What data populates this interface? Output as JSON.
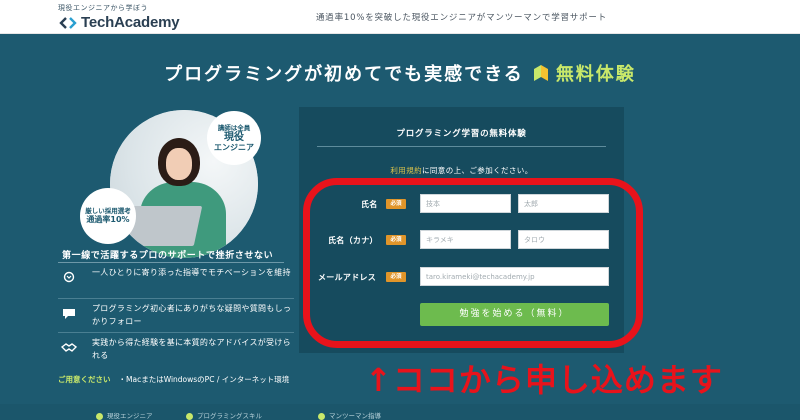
{
  "header": {
    "logo_sub": "現役エンジニアから学ぼう",
    "logo_text": "TechAcademy",
    "tagline": "通過率10%を突破した現役エンジニアがマンツーマンで学習サポート"
  },
  "headline": {
    "text": "プログラミングが初めてでも実感できる",
    "accent": "無料体験"
  },
  "badges": {
    "b1_line1": "講師は全員",
    "b1_line2": "現役",
    "b1_line3": "エンジニア",
    "b2_line1": "厳しい採用選考",
    "b2_line2": "通過率10%"
  },
  "left": {
    "section_title": "第一線で活躍するプロのサポートで挫折させない",
    "features": [
      {
        "text": "一人ひとりに寄り添った指導でモチベーションを維持"
      },
      {
        "text": "プログラミング初心者にありがちな疑問や質問もしっかりフォロー"
      },
      {
        "text": "実践から得た経験を基に本質的なアドバイスが受けられる"
      }
    ],
    "prep_label": "ご用意ください",
    "prep_value": "・MacまたはWindowsのPC / インターネット環境"
  },
  "form": {
    "title": "プログラミング学習の無料体験",
    "consent_link": "利用規約",
    "consent_rest": "に同意の上、ご参加ください。",
    "required_label": "必須",
    "name_label": "氏名",
    "kana_label": "氏名（カナ）",
    "email_label": "メールアドレス",
    "last_name_placeholder": "技本",
    "first_name_placeholder": "太郎",
    "last_kana_placeholder": "キラメキ",
    "first_kana_placeholder": "タロウ",
    "email_placeholder": "taro.kirameki@techacademy.jp",
    "submit_label": "勉強を始める（無料）"
  },
  "annotation": {
    "text": "↑ココから申し込めます"
  },
  "footer": {
    "items": [
      {
        "text": "現役エンジニア"
      },
      {
        "text": "プログラミングスキル"
      },
      {
        "text": "マンツーマン指導"
      }
    ]
  },
  "colors": {
    "background": "#1d5a70",
    "panel": "#164b5e",
    "accent_green": "#c9e86a",
    "button_green": "#6dbb4e",
    "required_orange": "#e0952a",
    "annotation_red": "#e8131b",
    "link_gold": "#d8c24b"
  }
}
